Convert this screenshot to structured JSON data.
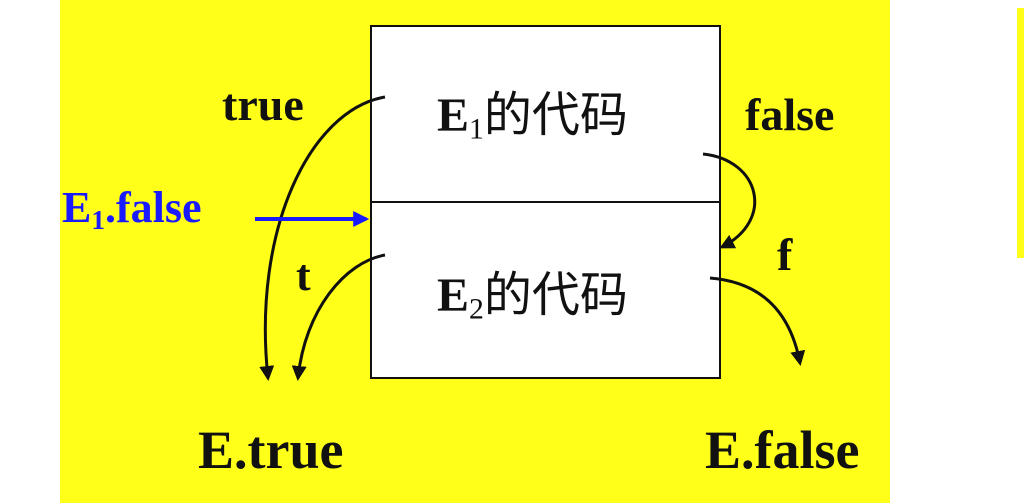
{
  "colors": {
    "background": "#ffff1a",
    "box_fill": "#ffffff",
    "arrow": "#111111",
    "highlight": "#1a1aff"
  },
  "box": {
    "e1": {
      "var": "E",
      "sub": "1",
      "text": "的代码"
    },
    "e2": {
      "var": "E",
      "sub": "2",
      "text": "的代码"
    }
  },
  "labels": {
    "true": "true",
    "false": "false",
    "t": "t",
    "f": "f",
    "e1_false": {
      "var": "E",
      "sub": "1",
      "rest": ".false"
    },
    "e_true": "E.true",
    "e_false": "E.false"
  }
}
